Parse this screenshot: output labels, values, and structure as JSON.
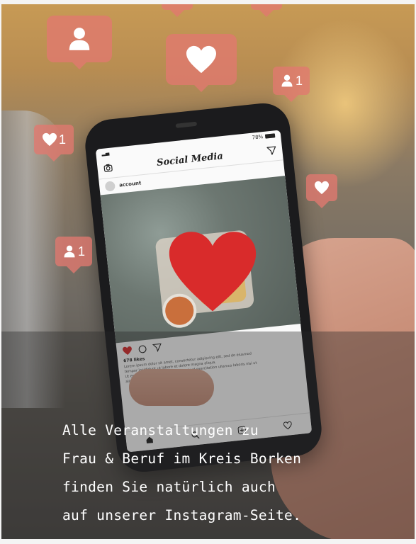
{
  "phone": {
    "status_time": "",
    "battery": "78%",
    "app_title": "Social Media",
    "account_name": "account",
    "likes": "678 likes",
    "caption_lines": [
      "Lorem ipsum dolor sit amet, consectetur adipiscing elit, sed do eiusmod",
      "tempor incididunt ut labore et dolore magna aliqua.",
      "Ut enim ad minim veniam, quis nostrud exercitation ullamco laboris nisi ut",
      "aliquip ex ea commodo consequat."
    ]
  },
  "notifications": [
    {
      "icon": "user-icon",
      "count": ""
    },
    {
      "icon": "heart-icon",
      "count": ""
    },
    {
      "icon": "user-icon",
      "count": "1"
    },
    {
      "icon": "heart-icon",
      "count": "1"
    },
    {
      "icon": "heart-icon",
      "count": ""
    },
    {
      "icon": "user-icon",
      "count": "1"
    }
  ],
  "message": {
    "lines": [
      "Alle Veranstaltungen zu",
      "Frau & Beruf im Kreis Borken",
      "finden Sie natürlich auch",
      "auf unserer Instagram-Seite."
    ]
  },
  "colors": {
    "bubble": "#e27870",
    "heart": "#d92b2b",
    "overlay_text": "#ffffff"
  }
}
